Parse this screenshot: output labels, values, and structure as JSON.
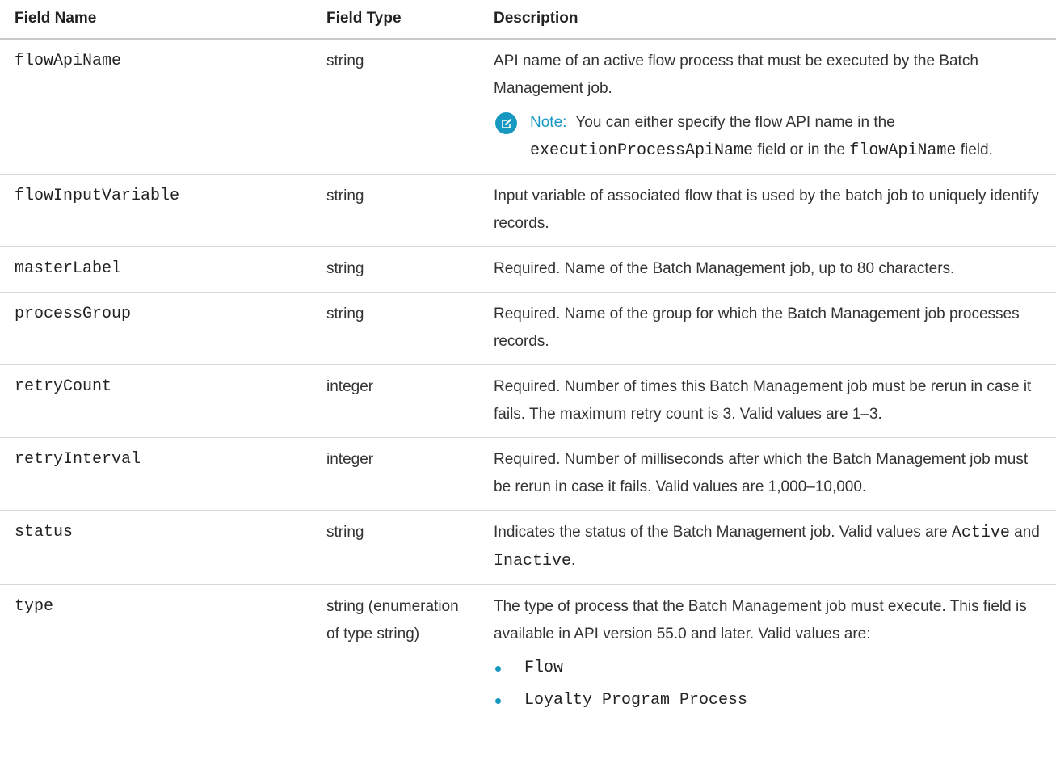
{
  "headers": {
    "field_name": "Field Name",
    "field_type": "Field Type",
    "description": "Description"
  },
  "rows": [
    {
      "name": "flowApiName",
      "type": "string",
      "desc": "API name of an active flow process that must be executed by the Batch Management job.",
      "note": {
        "label": "Note:",
        "text1": "You can either specify the flow API name in the",
        "code1": "executionProcessApiName",
        "text2": "field or in the",
        "code2": "flowApiName",
        "text3": "field."
      }
    },
    {
      "name": "flowInputVariable",
      "type": "string",
      "desc": "Input variable of associated flow that is used by the batch job to uniquely identify records."
    },
    {
      "name": "masterLabel",
      "type": "string",
      "desc": "Required. Name of the Batch Management job, up to 80 characters."
    },
    {
      "name": "processGroup",
      "type": "string",
      "desc": "Required. Name of the group for which the Batch Management job processes records."
    },
    {
      "name": "retryCount",
      "type": "integer",
      "desc": "Required. Number of times this Batch Management job must be rerun in case it fails. The maximum retry count is 3. Valid values are 1–3."
    },
    {
      "name": "retryInterval",
      "type": "integer",
      "desc": "Required. Number of milliseconds after which the Batch Management job must be rerun in case it fails. Valid values are 1,000–10,000."
    },
    {
      "name": "status",
      "type": "string",
      "desc_prefix": "Indicates the status of the Batch Management job. Valid values are",
      "code_active": "Active",
      "and_word": "and",
      "code_inactive": "Inactive",
      "period": "."
    },
    {
      "name": "type",
      "type": "string (enumeration of type string)",
      "desc": "The type of process that the Batch Management job must execute. This field is available in API version 55.0 and later. Valid values are:",
      "values": [
        "Flow",
        "Loyalty Program Process"
      ]
    }
  ],
  "colors": {
    "accent": "#1798c1",
    "text": "#333333",
    "rule": "#c9c9c9"
  },
  "icons": {
    "note": "edit-note-icon",
    "bullet": "bullet-dot"
  }
}
